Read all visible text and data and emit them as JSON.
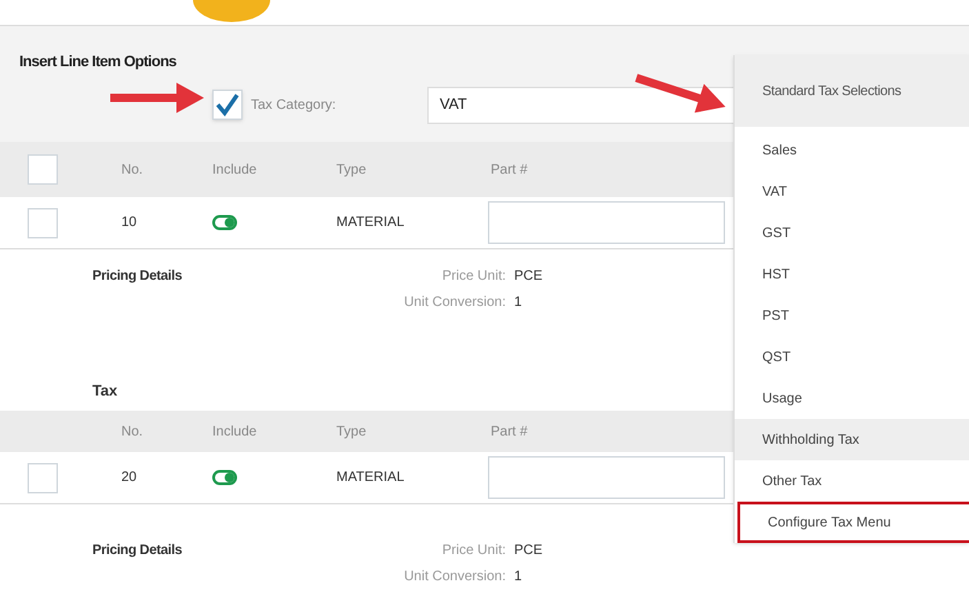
{
  "options": {
    "title": "Insert Line Item Options",
    "tax_category_checked": true,
    "tax_category_label": "Tax Category:",
    "tax_category_value": "VAT"
  },
  "items": [
    {
      "header_checkbox": {
        "checked": false
      },
      "columns": [
        "No.",
        "Include",
        "Type",
        "Part #"
      ],
      "select_checked": false,
      "no": "10",
      "include": true,
      "type": "MATERIAL",
      "pricing": {
        "title": "Pricing Details",
        "price_unit_label": "Price Unit:",
        "price_unit": "PCE",
        "unit_conversion_label": "Unit Conversion:",
        "unit_conversion": "1"
      }
    },
    {
      "heading": "Tax",
      "columns": [
        "No.",
        "Include",
        "Type",
        "Part #"
      ],
      "select_checked": false,
      "no": "20",
      "include": true,
      "type": "MATERIAL",
      "pricing": {
        "title": "Pricing Details",
        "price_unit_label": "Price Unit:",
        "price_unit": "PCE",
        "unit_conversion_label": "Unit Conversion:",
        "unit_conversion": "1"
      }
    }
  ],
  "menu": {
    "title": "Standard Tax Selections",
    "items": [
      {
        "label": "Sales",
        "highlighted": false,
        "outlined": false
      },
      {
        "label": "VAT",
        "highlighted": false,
        "outlined": false
      },
      {
        "label": "GST",
        "highlighted": false,
        "outlined": false
      },
      {
        "label": "HST",
        "highlighted": false,
        "outlined": false
      },
      {
        "label": "PST",
        "highlighted": false,
        "outlined": false
      },
      {
        "label": "QST",
        "highlighted": false,
        "outlined": false
      },
      {
        "label": "Usage",
        "highlighted": false,
        "outlined": false
      },
      {
        "label": "Withholding Tax",
        "highlighted": true,
        "outlined": false
      },
      {
        "label": "Other Tax",
        "highlighted": false,
        "outlined": false
      },
      {
        "label": "Configure Tax Menu",
        "highlighted": false,
        "outlined": true
      }
    ]
  }
}
